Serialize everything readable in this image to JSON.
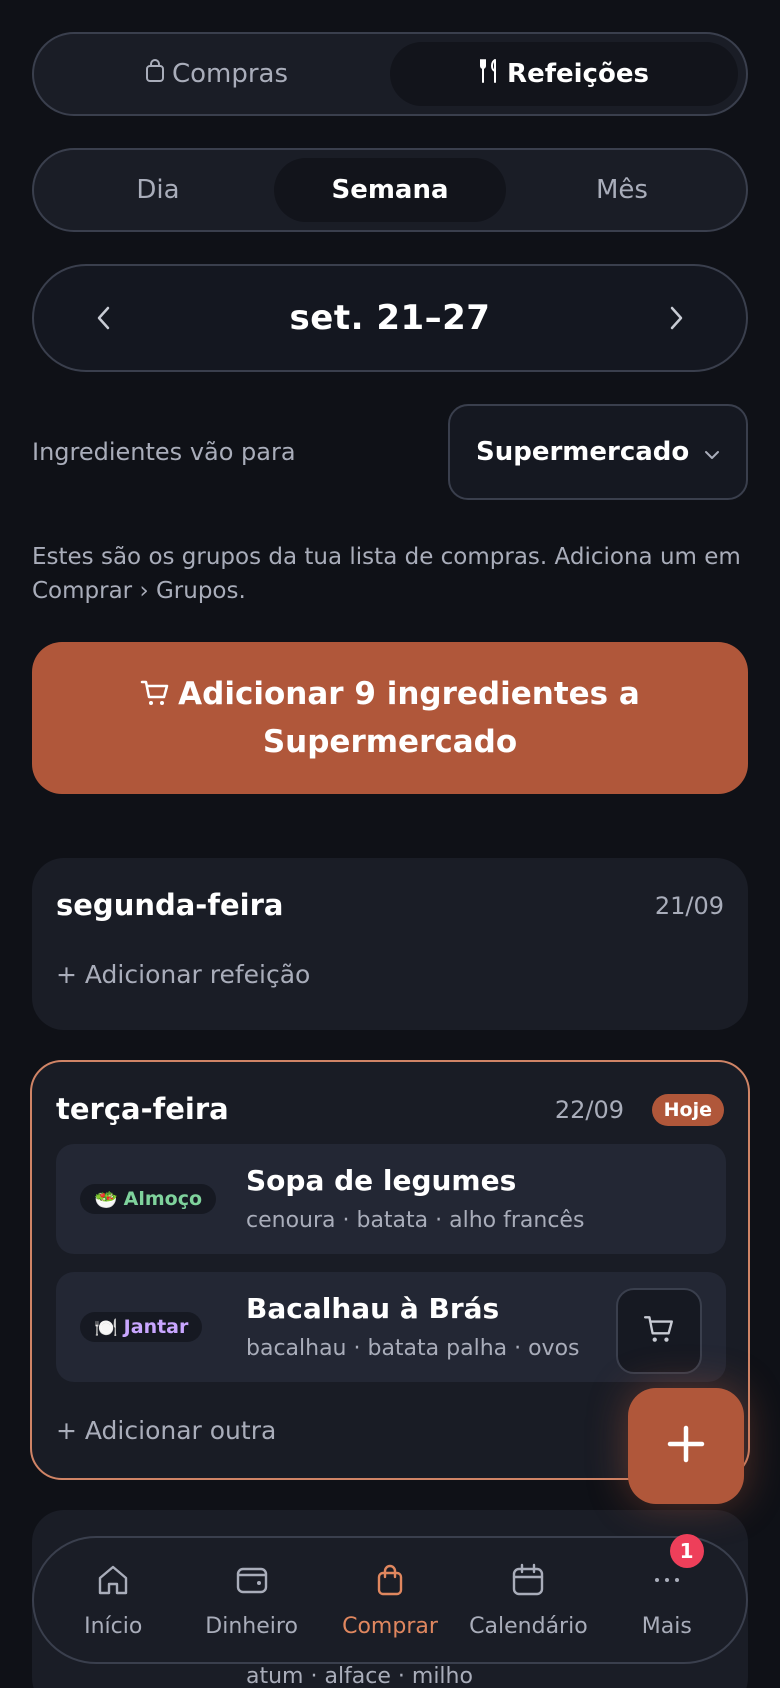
{
  "mode_switch": {
    "shopping_label": "Compras",
    "meals_label": "Refeições"
  },
  "period_switch": {
    "day": "Dia",
    "week": "Semana",
    "month": "Mês"
  },
  "week_nav": {
    "range": "set. 21–27"
  },
  "destination": {
    "label": "Ingredientes vão para",
    "selected": "Supermercado"
  },
  "hint": "Estes são os grupos da tua lista de compras. Adiciona um em Comprar › Grupos.",
  "cta": {
    "label": "Adicionar 9 ingredientes a Supermercado"
  },
  "days": [
    {
      "name": "segunda-feira",
      "date": "21/09",
      "add_label": "+ Adicionar refeição"
    },
    {
      "name": "terça-feira",
      "date": "22/09",
      "badge": "Hoje",
      "meals": [
        {
          "tag": "Almoço",
          "emoji": "🥗",
          "title": "Sopa de legumes",
          "ingredients": "cenoura · batata · alho francês"
        },
        {
          "tag": "Jantar",
          "emoji": "🍽️",
          "title": "Bacalhau à Brás",
          "ingredients": "bacalhau · batata palha · ovos"
        }
      ],
      "add_label": "+ Adicionar outra"
    },
    {
      "partial_ingredients": "atum · alface · milho"
    }
  ],
  "tabbar": {
    "items": [
      {
        "label": "Início",
        "icon": "home-icon"
      },
      {
        "label": "Dinheiro",
        "icon": "wallet-icon"
      },
      {
        "label": "Comprar",
        "icon": "bag-icon"
      },
      {
        "label": "Calendário",
        "icon": "calendar-icon"
      },
      {
        "label": "Mais",
        "icon": "more-icon"
      }
    ],
    "active": "Comprar",
    "more_badge": "1"
  },
  "colors": {
    "accent": "#b0573a",
    "today_border": "#d08466",
    "green_tag": "#7fd29c",
    "purple_tag": "#c9a6ff",
    "badge": "#ee3f5a"
  }
}
